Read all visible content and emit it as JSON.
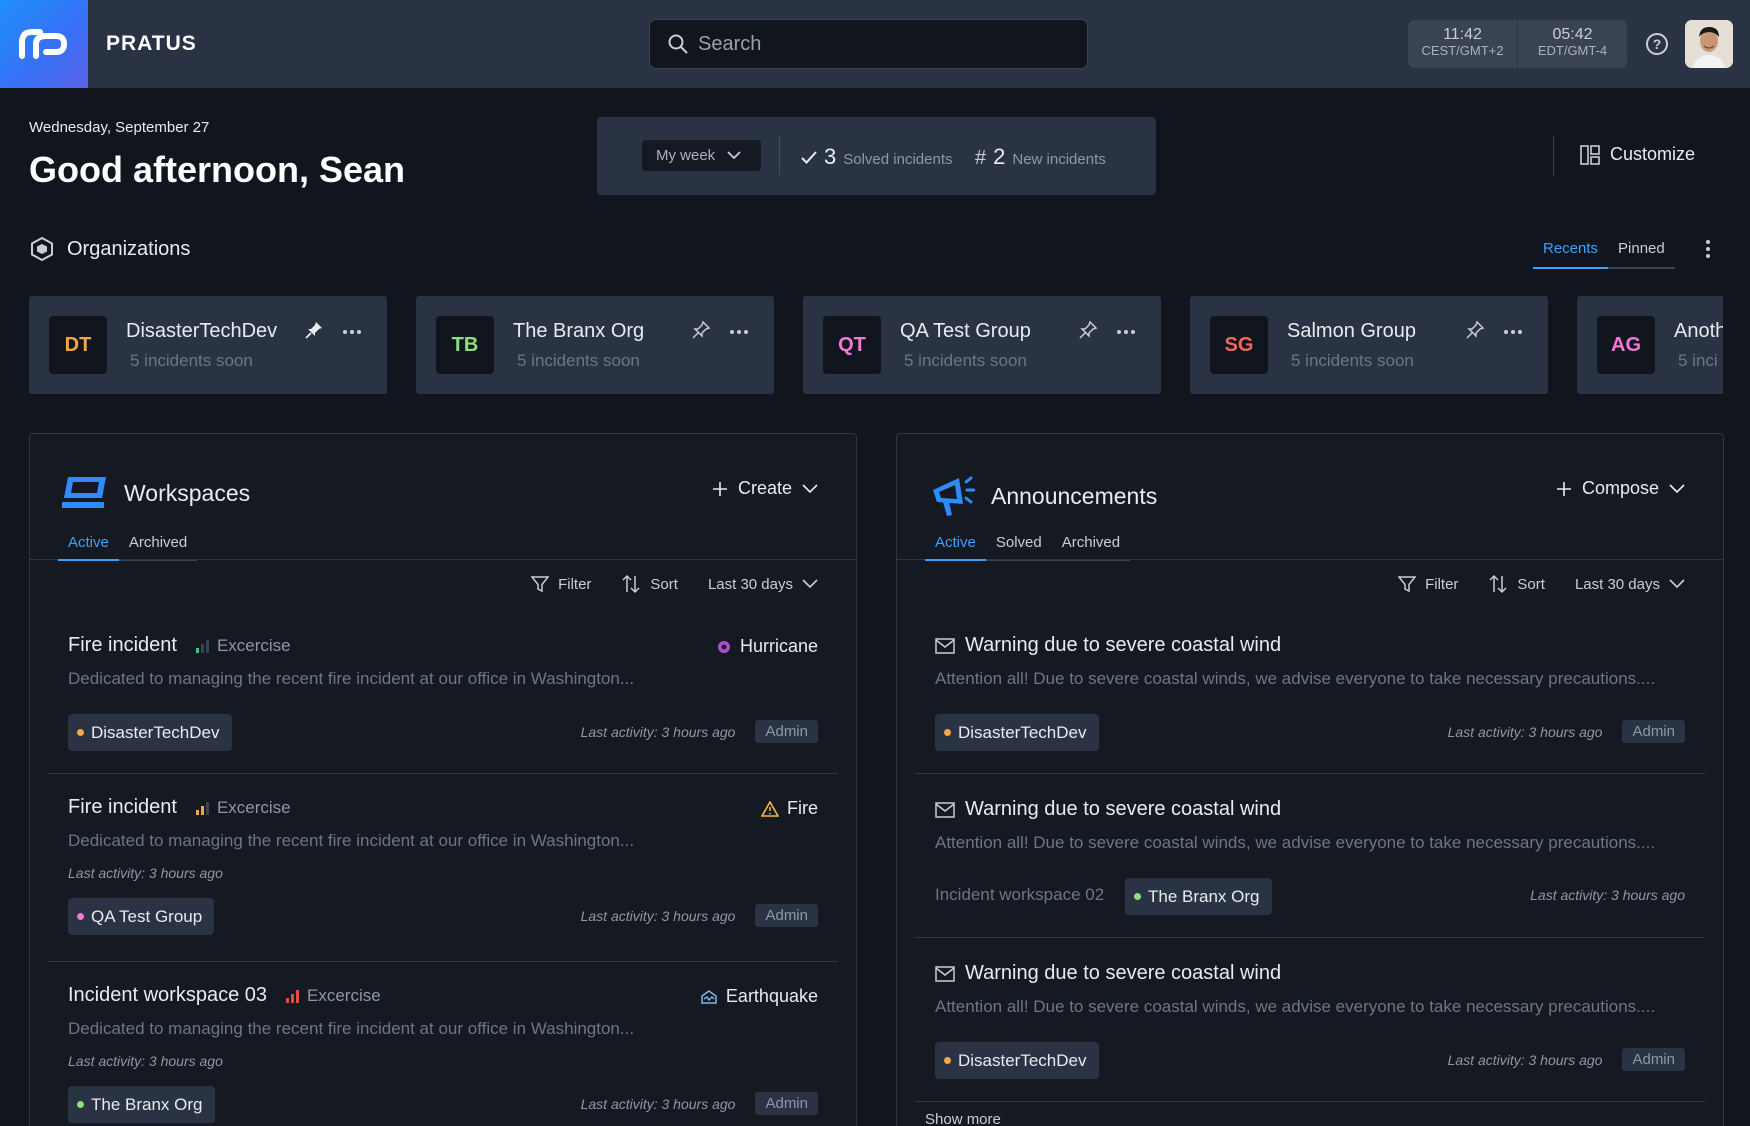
{
  "header": {
    "brand": "PRATUS",
    "search_placeholder": "Search",
    "clocks": [
      {
        "time": "11:42",
        "zone": "CEST/GMT+2"
      },
      {
        "time": "05:42",
        "zone": "EDT/GMT-4"
      }
    ],
    "help_glyph": "?"
  },
  "greeting": {
    "date": "Wednesday, September 27",
    "title": "Good afternoon, Sean"
  },
  "summary": {
    "period": "My week",
    "solved_count": "3",
    "solved_label": "Solved incidents",
    "new_symbol": "#",
    "new_count": "2",
    "new_label": "New incidents"
  },
  "customize_label": "Customize",
  "organizations": {
    "title": "Organizations",
    "tabs": [
      {
        "label": "Recents",
        "active": true
      },
      {
        "label": "Pinned",
        "active": false
      }
    ],
    "cards": [
      {
        "initials": "DT",
        "color": "#f5a742",
        "name": "DisasterTechDev",
        "sub": "5 incidents soon"
      },
      {
        "initials": "TB",
        "color": "#8fe07b",
        "name": "The Branx Org",
        "sub": "5 incidents soon"
      },
      {
        "initials": "QT",
        "color": "#f07ad6",
        "name": "QA Test Group",
        "sub": "5 incidents soon"
      },
      {
        "initials": "SG",
        "color": "#f06a5c",
        "name": "Salmon Group",
        "sub": "5 incidents soon"
      },
      {
        "initials": "AG",
        "color": "#f07ad6",
        "name": "Anoth",
        "sub": "5 inci"
      }
    ]
  },
  "workspaces": {
    "title": "Workspaces",
    "action": "Create",
    "tabs": [
      {
        "label": "Active",
        "active": true
      },
      {
        "label": "Archived",
        "active": false
      }
    ],
    "toolbar": {
      "filter": "Filter",
      "sort": "Sort",
      "range": "Last 30 days"
    },
    "items": [
      {
        "title": "Fire incident",
        "kind": "Excercise",
        "tag": "Hurricane",
        "desc": "Dedicated to managing the recent fire incident at our office in Washington...",
        "chip": "DisasterTechDev",
        "chip_color": "#f5a742",
        "last": "Last activity: 3 hours ago",
        "role": "Admin"
      },
      {
        "title": "Fire incident",
        "kind": "Excercise",
        "tag": "Fire",
        "desc": "Dedicated to managing the recent fire incident at our office in Washington...",
        "last_inline": "Last activity: 3 hours ago",
        "chip": "QA Test Group",
        "chip_color": "#f07ad6",
        "last": "Last activity: 3 hours ago",
        "role": "Admin"
      },
      {
        "title": "Incident workspace 03",
        "kind": "Excercise",
        "tag": "Earthquake",
        "desc": "Dedicated to managing the recent fire incident at our office in Washington...",
        "last_inline": "Last activity: 3 hours ago",
        "chip": "The Branx Org",
        "chip_color": "#8fe07b",
        "last": "Last activity: 3 hours ago",
        "role": "Admin"
      }
    ]
  },
  "announcements": {
    "title": "Announcements",
    "action": "Compose",
    "tabs": [
      {
        "label": "Active",
        "active": true
      },
      {
        "label": "Solved",
        "active": false
      },
      {
        "label": "Archived",
        "active": false
      }
    ],
    "toolbar": {
      "filter": "Filter",
      "sort": "Sort",
      "range": "Last 30 days"
    },
    "items": [
      {
        "title": "Warning due to severe coastal wind",
        "desc": "Attention all! Due to severe coastal winds, we advise everyone to take necessary precautions....",
        "chip": "DisasterTechDev",
        "chip_color": "#f5a742",
        "last": "Last activity: 3 hours ago",
        "role": "Admin"
      },
      {
        "title": "Warning due to severe coastal wind",
        "desc": "Attention all! Due to severe coastal winds, we advise everyone to take necessary precautions....",
        "workspace": "Incident workspace 02",
        "chip": "The Branx Org",
        "chip_color": "#8fe07b",
        "last": "Last activity: 3 hours ago"
      },
      {
        "title": "Warning due to severe coastal wind",
        "desc": "Attention all! Due to severe coastal winds, we advise everyone to take necessary precautions....",
        "chip": "DisasterTechDev",
        "chip_color": "#f5a742",
        "last": "Last activity: 3 hours ago",
        "role": "Admin"
      }
    ],
    "show_more": "Show more"
  }
}
